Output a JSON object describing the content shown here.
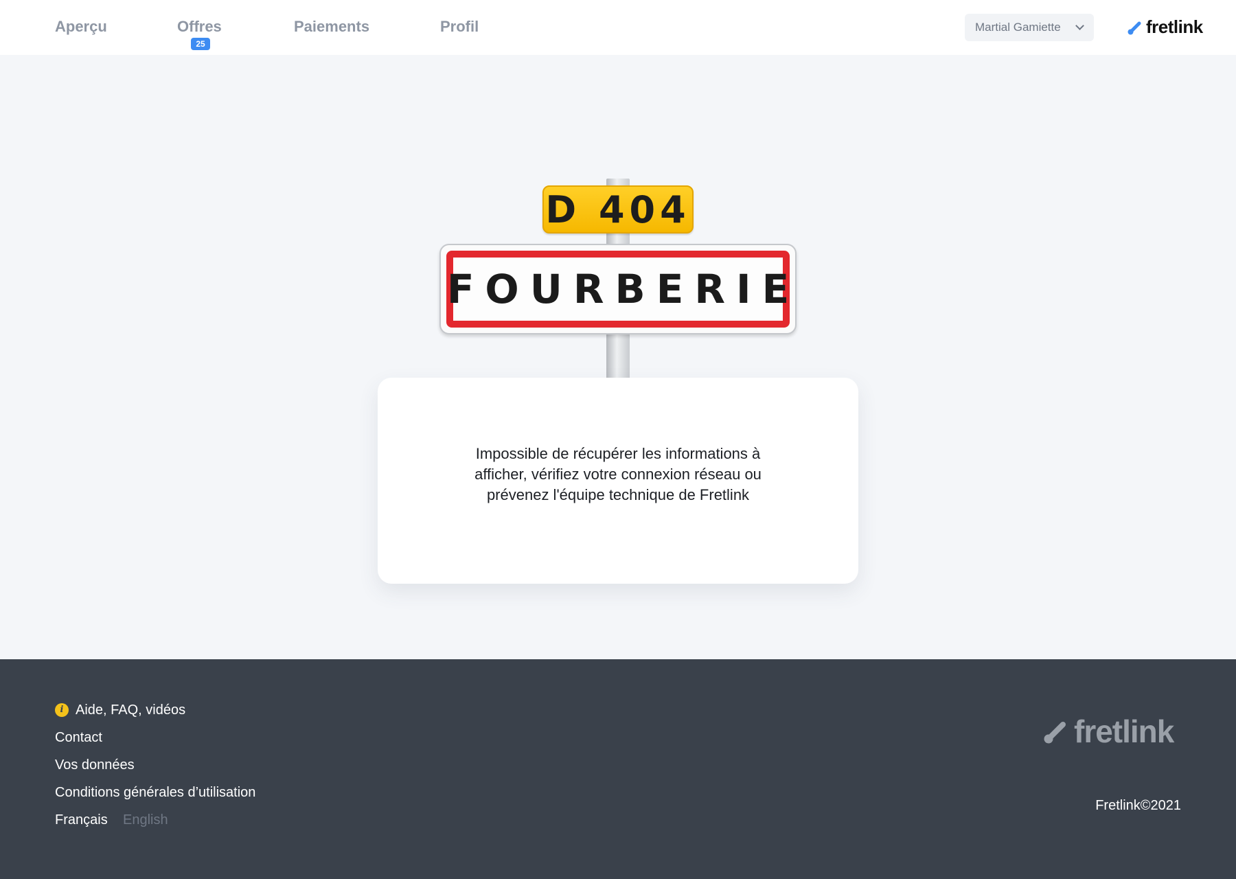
{
  "nav": {
    "apercu": "Aperçu",
    "offres": "Offres",
    "offres_count": "25",
    "paiements": "Paiements",
    "profil": "Profil"
  },
  "user": {
    "name": "Martial Gamiette"
  },
  "brand": {
    "name": "fretlink",
    "accent": "#3d8cf2"
  },
  "sign": {
    "route": "D 404",
    "town": "FOURBERIE"
  },
  "error": {
    "line1": "Impossible de récupérer les informations à",
    "line2": "afficher, vérifiez votre connexion réseau ou",
    "line3": "prévenez l'équipe technique de Fretlink"
  },
  "footer": {
    "help": "Aide, FAQ, vidéos",
    "contact": "Contact",
    "data": "Vos données",
    "terms": "Conditions générales d’utilisation",
    "lang_fr": "Français",
    "lang_en": "English",
    "copyright": "Fretlink©2021"
  }
}
